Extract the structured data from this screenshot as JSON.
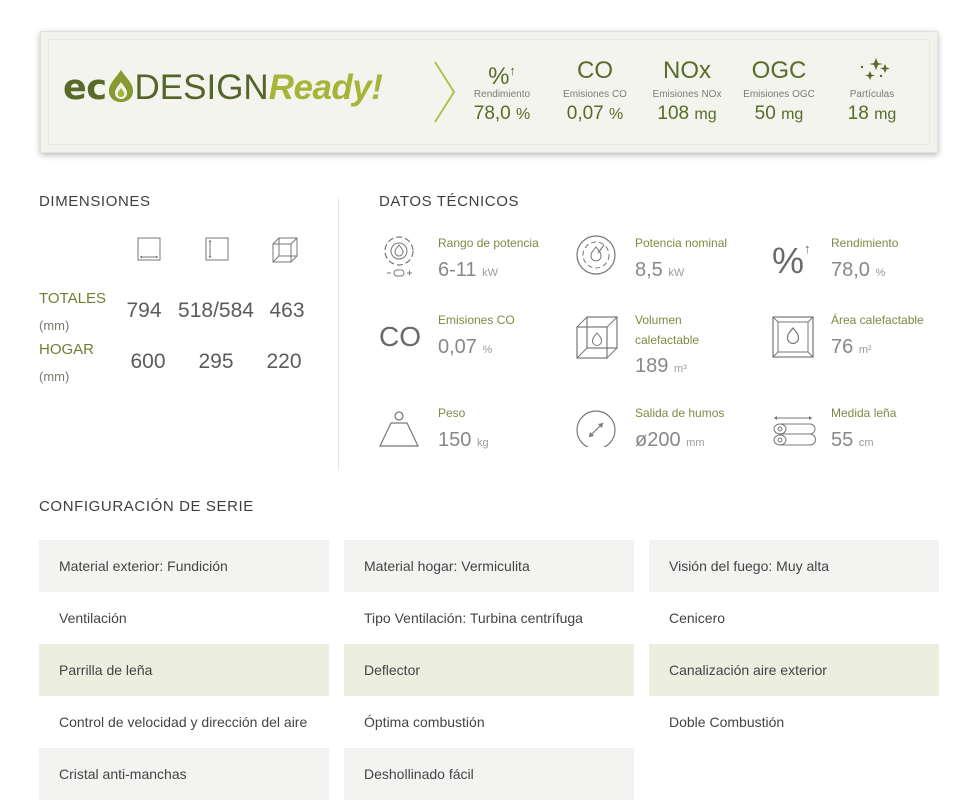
{
  "banner": {
    "logo": {
      "eco_prefix": "ec",
      "design": "DESIGN",
      "ready": "Ready!"
    },
    "metrics": [
      {
        "symbol": "%",
        "label": "Rendimiento",
        "value": "78,0",
        "unit": "%"
      },
      {
        "symbol": "CO",
        "label": "Emisiones CO",
        "value": "0,07",
        "unit": "%"
      },
      {
        "symbol": "NOx",
        "label": "Emisiones NOx",
        "value": "108",
        "unit": "mg"
      },
      {
        "symbol": "OGC",
        "label": "Emisiones OGC",
        "value": "50",
        "unit": "mg"
      },
      {
        "symbol": "",
        "label": "Partículas",
        "value": "18",
        "unit": "mg"
      }
    ]
  },
  "dimensiones": {
    "title": "DIMENSIONES",
    "rows": [
      {
        "label": "TOTALES",
        "unit": "(mm)",
        "values": [
          "794",
          "518/584",
          "463"
        ]
      },
      {
        "label": "HOGAR",
        "unit": "(mm)",
        "values": [
          "600",
          "295",
          "220"
        ]
      }
    ]
  },
  "datos": {
    "title": "DATOS TÉCNICOS",
    "items": [
      {
        "label": "Rango de potencia",
        "value": "6-11",
        "unit": "kW",
        "icon": "power-range-icon"
      },
      {
        "label": "Potencia nominal",
        "value": "8,5",
        "unit": "kW",
        "icon": "nominal-power-icon"
      },
      {
        "label": "Rendimiento",
        "value": "78,0",
        "unit": "%",
        "icon": "efficiency-icon"
      },
      {
        "label": "Emisiones CO",
        "value": "0,07",
        "unit": "%",
        "icon": "co-icon",
        "symbol": "CO"
      },
      {
        "label": "Volumen calefactable",
        "value": "189",
        "unit": "m³",
        "icon": "volume-icon"
      },
      {
        "label": "Área calefactable",
        "value": "76",
        "unit": "m²",
        "icon": "area-icon"
      },
      {
        "label": "Peso",
        "value": "150",
        "unit": "kg",
        "icon": "weight-icon"
      },
      {
        "label": "Salida de humos",
        "value": "ø200",
        "unit": "mm",
        "icon": "flue-outlet-icon"
      },
      {
        "label": "Medida leña",
        "value": "55",
        "unit": "cm",
        "icon": "firewood-icon"
      }
    ]
  },
  "config": {
    "title": "CONFIGURACIÓN DE SERIE",
    "items": [
      "Material exterior: Fundición",
      "Material hogar: Vermiculita",
      "Visión del fuego: Muy alta",
      "Ventilación",
      "Tipo Ventilación: Turbina centrífuga",
      "Cenicero",
      "Parrilla de leña",
      "Deflector",
      "Canalización aire exterior",
      "Control de velocidad y dirección del aire",
      "Óptima combustión",
      "Doble Combustión",
      "Cristal anti-manchas",
      "Deshollinado fácil"
    ]
  }
}
